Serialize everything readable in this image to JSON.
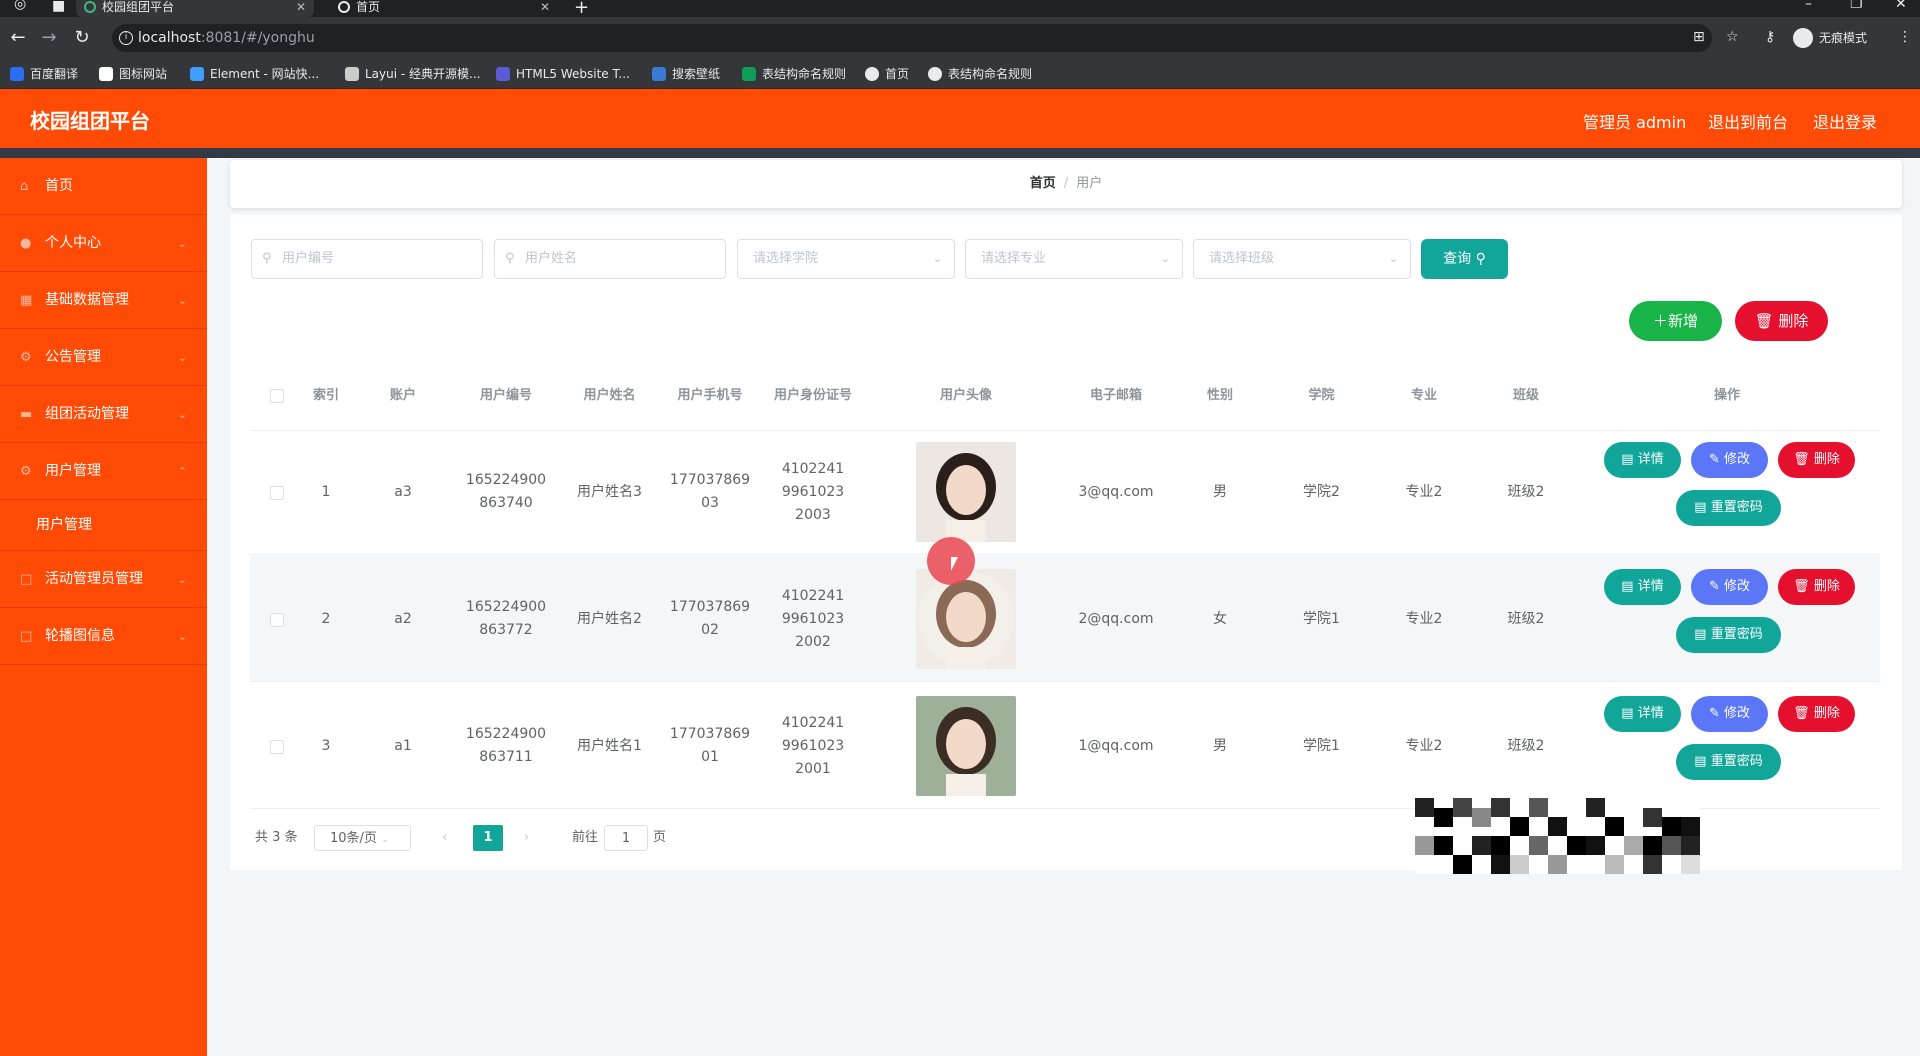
{
  "browser": {
    "tabs": [
      {
        "title": "校园组团平台",
        "active": true
      },
      {
        "title": "首页",
        "active": false
      }
    ],
    "url_host": "localhost",
    "url_path": ":8081/#/yonghu",
    "incognito_label": "无痕模式",
    "bookmarks": [
      {
        "label": "百度翻译",
        "color": "#2b6ef2"
      },
      {
        "label": "图标网站",
        "color": "#ffffff"
      },
      {
        "label": "Element - 网站快...",
        "color": "#409eff"
      },
      {
        "label": "Layui - 经典开源模...",
        "color": "#cccccc"
      },
      {
        "label": "HTML5 Website T...",
        "color": "#5b5bd6"
      },
      {
        "label": "搜索壁纸",
        "color": "#3a7bd5"
      },
      {
        "label": "表结构命名规则",
        "color": "#0f9d58"
      },
      {
        "label": "首页",
        "color": "#e8eaed"
      },
      {
        "label": "表结构命名规则",
        "color": "#e8eaed"
      }
    ]
  },
  "header": {
    "brand": "校园组团平台",
    "admin": "管理员 admin",
    "front": "退出到前台",
    "logout": "退出登录"
  },
  "sidebar": {
    "items": [
      {
        "label": "首页",
        "icon": "home-icon",
        "glyph": "⌂"
      },
      {
        "label": "个人中心",
        "icon": "user-icon",
        "glyph": "●"
      },
      {
        "label": "基础数据管理",
        "icon": "grid-icon",
        "glyph": "▦"
      },
      {
        "label": "公告管理",
        "icon": "gear-icon",
        "glyph": "⚙"
      },
      {
        "label": "组团活动管理",
        "icon": "chat-icon",
        "glyph": "▬"
      },
      {
        "label": "用户管理",
        "icon": "gear-icon",
        "glyph": "⚙"
      },
      {
        "label": "用户管理",
        "icon": "",
        "glyph": ""
      },
      {
        "label": "活动管理员管理",
        "icon": "box-icon",
        "glyph": "□"
      },
      {
        "label": "轮播图信息",
        "icon": "box-icon",
        "glyph": "□"
      }
    ]
  },
  "breadcrumb": {
    "home": "首页",
    "sep": "/",
    "current": "用户"
  },
  "filters": {
    "user_no_placeholder": "用户编号",
    "user_name_placeholder": "用户姓名",
    "college_placeholder": "请选择学院",
    "major_placeholder": "请选择专业",
    "class_placeholder": "请选择班级",
    "query_label": "查询"
  },
  "actions": {
    "add_label": "新增",
    "delete_label": "删除"
  },
  "table": {
    "headers": [
      "索引",
      "账户",
      "用户编号",
      "用户姓名",
      "用户手机号",
      "用户身份证号",
      "用户头像",
      "电子邮箱",
      "性别",
      "学院",
      "专业",
      "班级",
      "操作"
    ],
    "rows": [
      {
        "index": "1",
        "account": "a3",
        "user_no": "165224900863740",
        "name": "用户姓名3",
        "phone": "17703786903",
        "id_card": "410224199610232003",
        "email": "3@qq.com",
        "gender": "男",
        "college": "学院2",
        "major": "专业2",
        "class": "班级2"
      },
      {
        "index": "2",
        "account": "a2",
        "user_no": "165224900863772",
        "name": "用户姓名2",
        "phone": "17703786902",
        "id_card": "410224199610232002",
        "email": "2@qq.com",
        "gender": "女",
        "college": "学院1",
        "major": "专业2",
        "class": "班级2"
      },
      {
        "index": "3",
        "account": "a1",
        "user_no": "165224900863711",
        "name": "用户姓名1",
        "phone": "17703786901",
        "id_card": "410224199610232001",
        "email": "1@qq.com",
        "gender": "男",
        "college": "学院1",
        "major": "专业2",
        "class": "班级2"
      }
    ],
    "row_actions": {
      "detail": "详情",
      "edit": "修改",
      "delete": "删除",
      "reset": "重置密码"
    }
  },
  "pagination": {
    "total": "共 3 条",
    "page_size": "10条/页",
    "current": "1",
    "goto_prefix": "前往",
    "goto_value": "1",
    "goto_suffix": "页"
  },
  "colors": {
    "brand": "#ff4b05",
    "teal": "#12a59a",
    "blue": "#5b76f6",
    "red": "#e5102d",
    "green": "#19b448"
  }
}
